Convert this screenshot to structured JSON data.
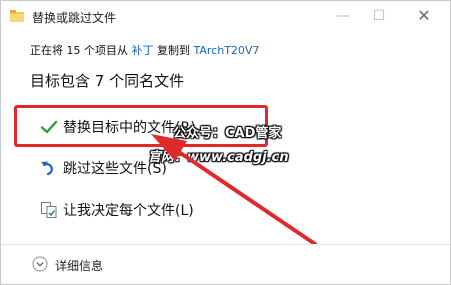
{
  "window": {
    "title": "替换或跳过文件"
  },
  "titlebar": {
    "minimize_glyph": "—",
    "maximize_glyph": "☐",
    "close_glyph": "✕"
  },
  "info": {
    "prefix": "正在将 15 个项目从",
    "source": "补丁",
    "middle": "复制到",
    "destination": "TArchT20V7"
  },
  "heading": "目标包含 7 个同名文件",
  "options": {
    "replace": {
      "label": "替换目标中的文件(R)",
      "icon": "check-icon"
    },
    "skip": {
      "label": "跳过这些文件(S)",
      "icon": "skip-icon"
    },
    "decide": {
      "label": "让我决定每个文件(L)",
      "icon": "compare-files-icon"
    }
  },
  "watermark": {
    "line1": "公众号：CAD管家",
    "line2": "官网：www.cadgj.cn"
  },
  "footer": {
    "details_label": "详细信息",
    "details_icon": "chevron-down-icon"
  },
  "colors": {
    "highlight": "#e0292a",
    "link": "#1a66c2",
    "check": "#2e9e3e"
  }
}
